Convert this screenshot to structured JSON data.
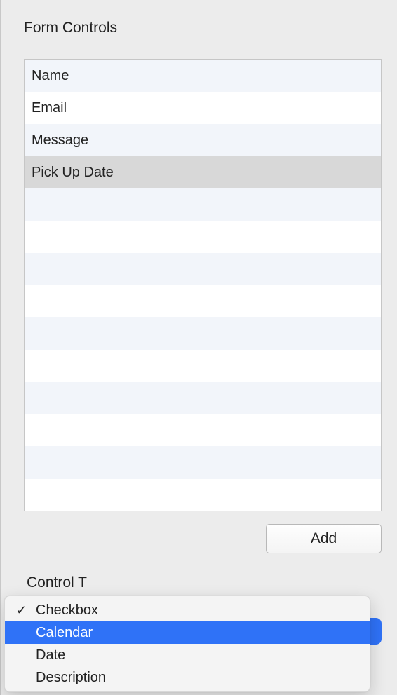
{
  "panel": {
    "title": "Form Controls"
  },
  "list": {
    "rows": [
      {
        "label": "Name",
        "selected": false
      },
      {
        "label": "Email",
        "selected": false
      },
      {
        "label": "Message",
        "selected": false
      },
      {
        "label": "Pick Up Date",
        "selected": true
      },
      {
        "label": "",
        "selected": false
      },
      {
        "label": "",
        "selected": false
      },
      {
        "label": "",
        "selected": false
      },
      {
        "label": "",
        "selected": false
      },
      {
        "label": "",
        "selected": false
      },
      {
        "label": "",
        "selected": false
      },
      {
        "label": "",
        "selected": false
      },
      {
        "label": "",
        "selected": false
      },
      {
        "label": "",
        "selected": false
      },
      {
        "label": "",
        "selected": false
      }
    ]
  },
  "buttons": {
    "add_label": "Add"
  },
  "section": {
    "control_type_label_partial": "Control T"
  },
  "dropdown": {
    "items": [
      {
        "label": "Checkbox",
        "checked": true,
        "highlighted": false
      },
      {
        "label": "Calendar",
        "checked": false,
        "highlighted": true
      },
      {
        "label": "Date",
        "checked": false,
        "highlighted": false
      },
      {
        "label": "Description",
        "checked": false,
        "highlighted": false
      }
    ]
  }
}
